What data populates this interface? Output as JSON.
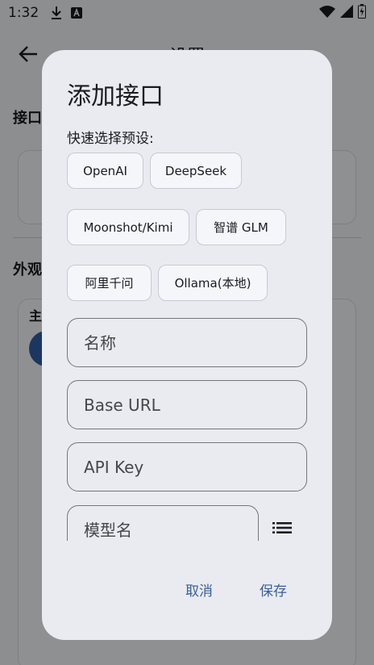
{
  "status_bar": {
    "time": "1:32"
  },
  "background": {
    "title": "设置",
    "section_interface": "接口",
    "section_appearance": "外观",
    "appearance_item_prefix": "主"
  },
  "dialog": {
    "title": "添加接口",
    "preset_label": "快速选择预设:",
    "presets": [
      "OpenAI",
      "DeepSeek",
      "Moonshot/Kimi",
      "智谱 GLM",
      "阿里千问",
      "Ollama(本地)"
    ],
    "fields": {
      "name_placeholder": "名称",
      "base_url_placeholder": "Base URL",
      "api_key_placeholder": "API Key",
      "model_placeholder": "模型名"
    },
    "cancel_label": "取消",
    "save_label": "保存"
  },
  "colors": {
    "dialog_bg": "#e9ebf1",
    "accent": "#3a5f98",
    "scrim": "rgba(0,0,0,0.42)"
  },
  "icons": [
    "back-arrow-icon",
    "download-icon",
    "keyboard-icon",
    "wifi-icon",
    "signal-icon",
    "battery-icon",
    "list-icon"
  ]
}
